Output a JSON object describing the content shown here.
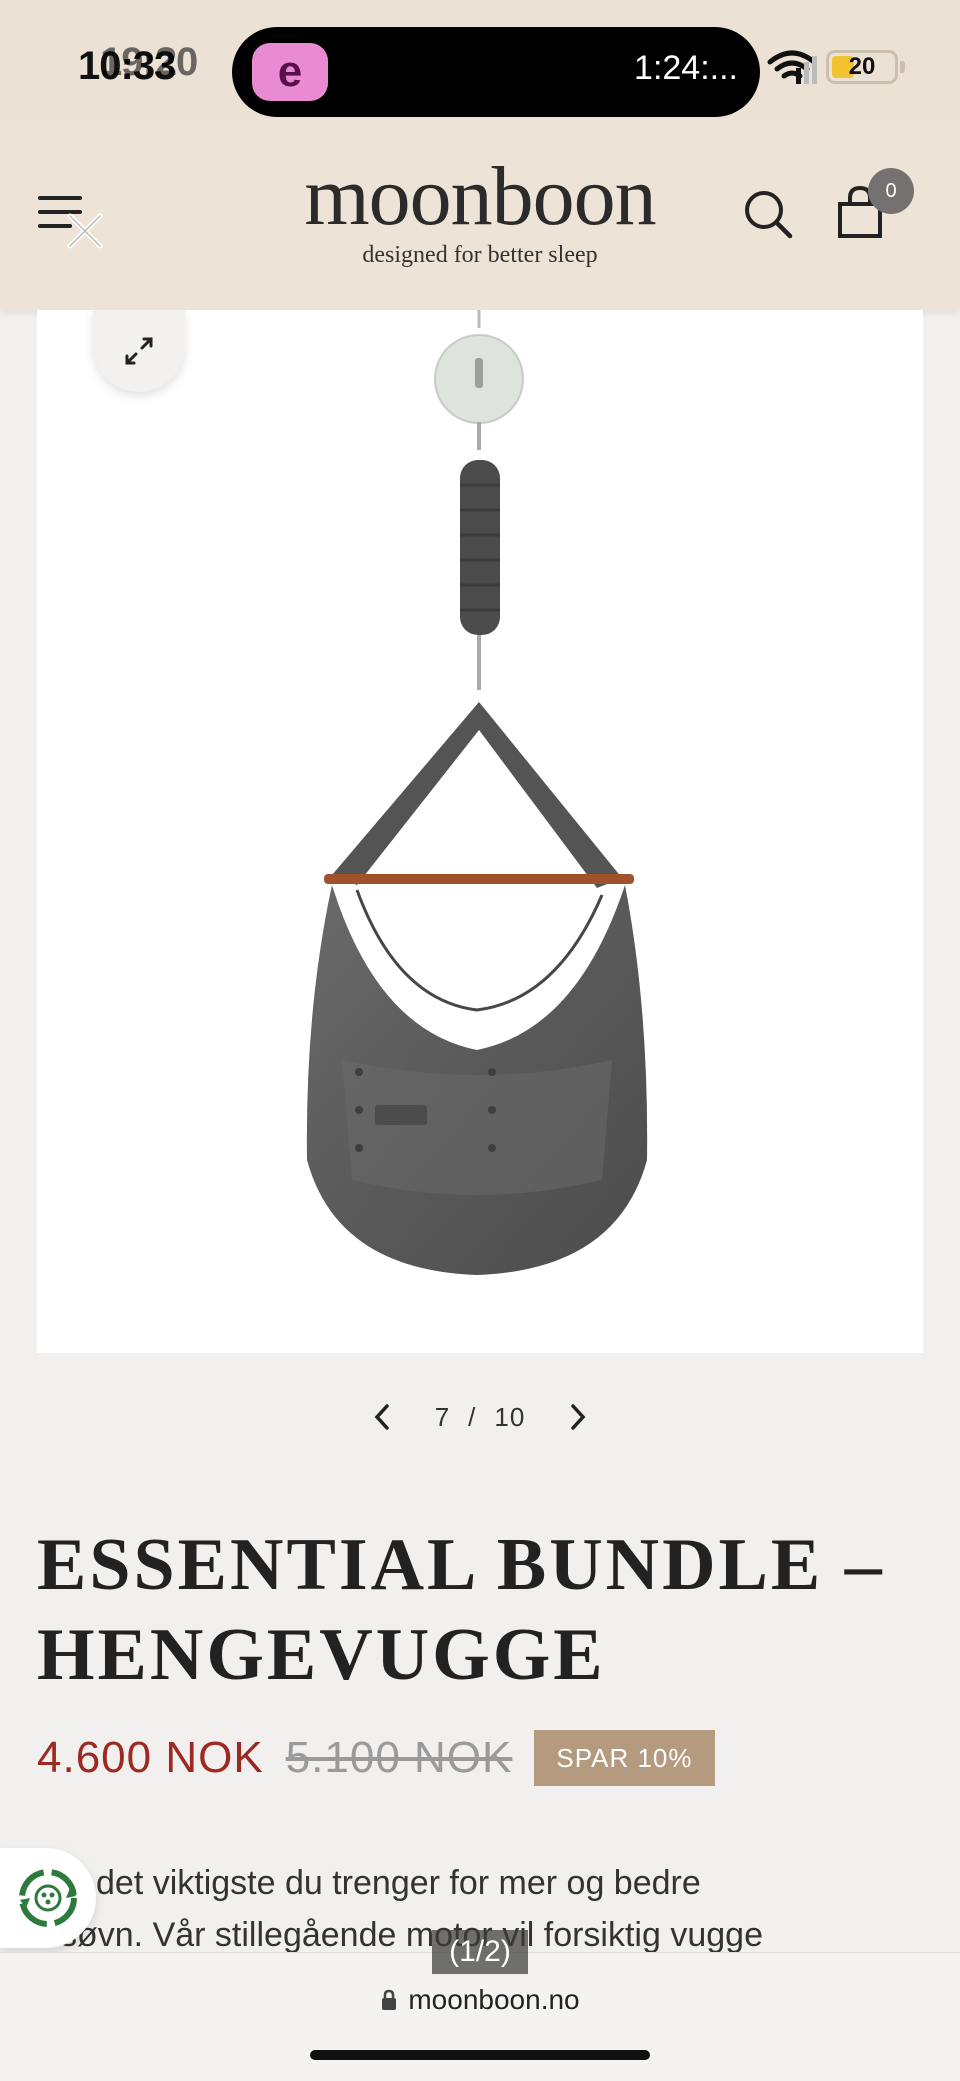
{
  "status_bar": {
    "time": "10:33",
    "time_overlay": "19:20",
    "island_app_letter": "e",
    "island_timer": "1:24:...",
    "battery_level": "20",
    "colors": {
      "island_app": "#e98bd3",
      "battery": "#f2c230"
    }
  },
  "header": {
    "logo": "moonboon",
    "tagline": "designed for better sleep",
    "cart_count": "0",
    "icons": [
      "menu-icon",
      "close-icon",
      "search-icon",
      "shopping-bag-icon"
    ]
  },
  "gallery": {
    "current": "7",
    "separator": "/",
    "total": "10",
    "icons": [
      "expand-icon",
      "chevron-left-icon",
      "chevron-right-icon"
    ]
  },
  "product": {
    "title": "ESSENTIAL BUNDLE – HENGEVUGGE",
    "price": "4.600 NOK",
    "original_price": "5.100 NOK",
    "badge": "SPAR 10%",
    "description_line1": "det viktigste du trenger for mer og bedre",
    "description_line2": "søvn. Vår stillegående motor vil forsiktig vugge",
    "colors": {
      "price": "#9c2a22",
      "badge": "#b49a7e"
    }
  },
  "browser": {
    "page_indicator": "(1/2)",
    "url": "moonboon.no"
  }
}
